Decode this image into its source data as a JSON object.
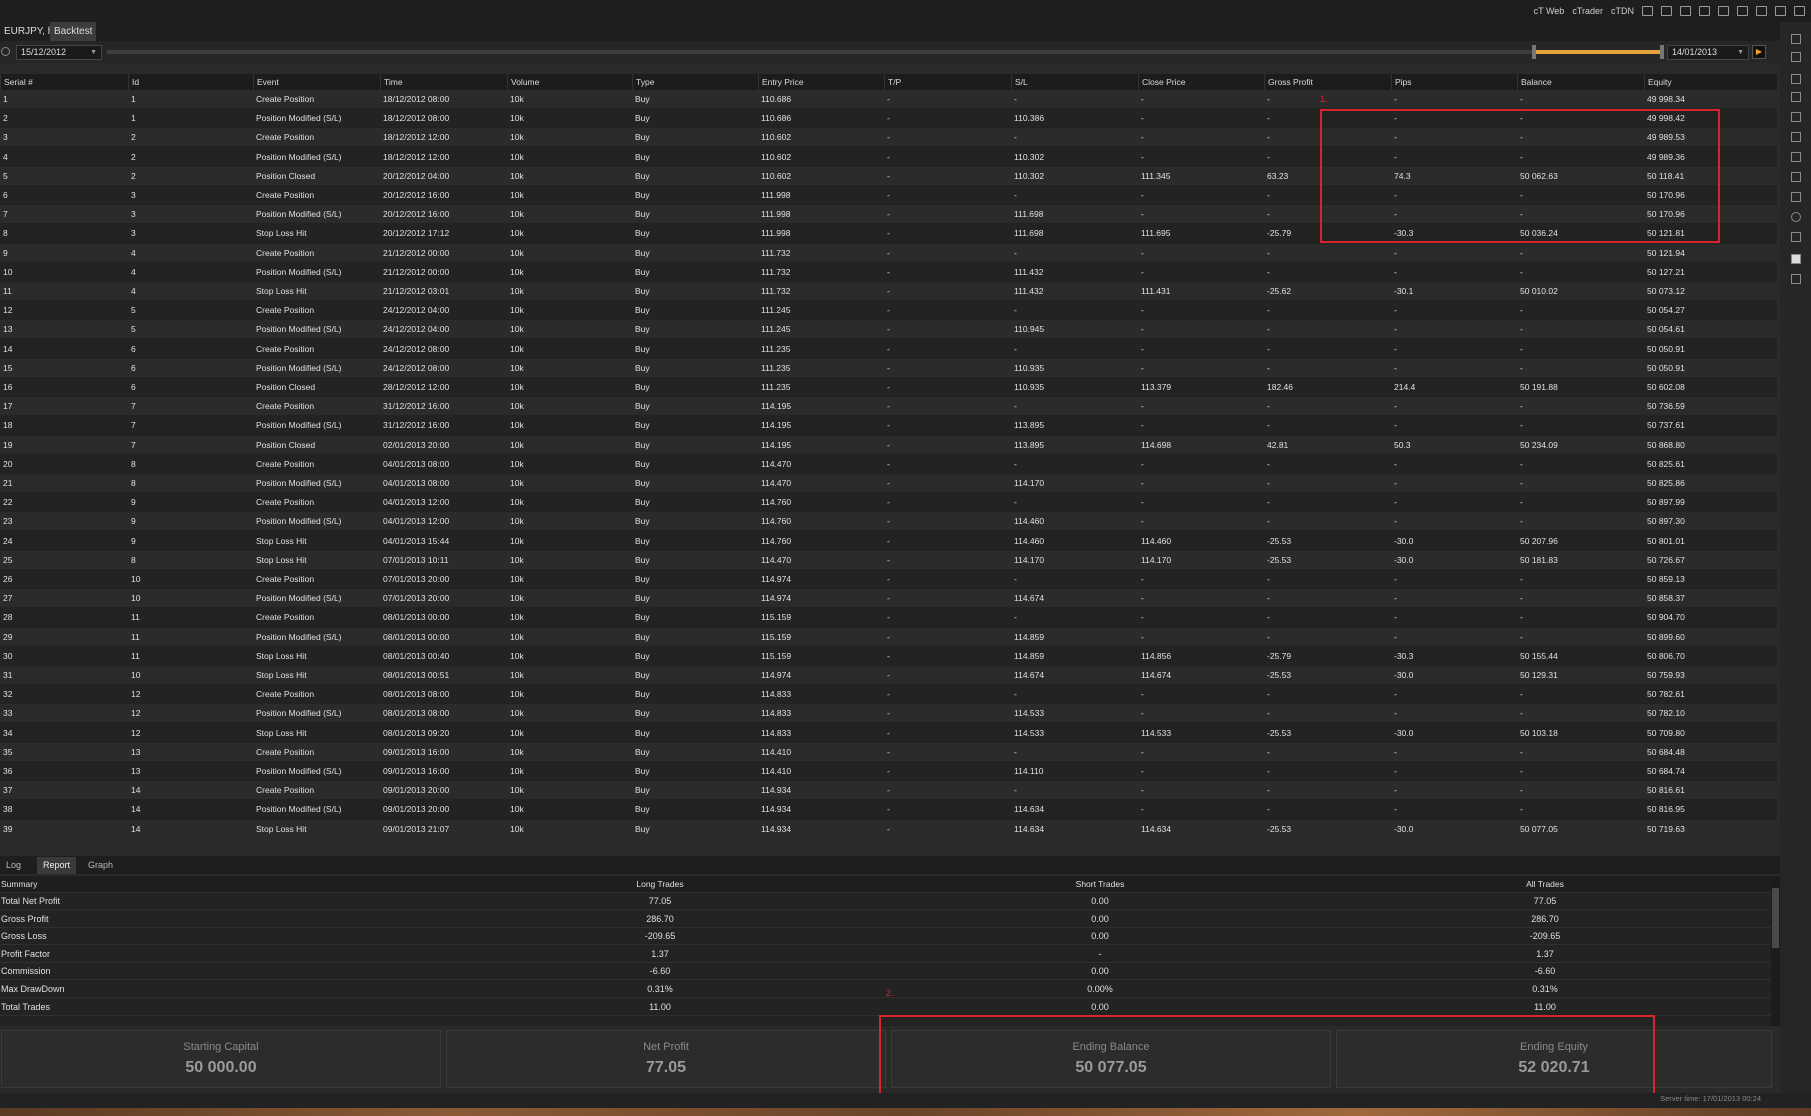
{
  "window": {
    "title": "EURJPY, h4",
    "tab_backtest": "Backtest"
  },
  "top_links": [
    "cT Web",
    "cTrader",
    "cTDN"
  ],
  "date_from": "15/12/2012",
  "date_to": "14/01/2013",
  "table": {
    "columns": [
      "Serial #",
      "Id",
      "Event",
      "Time",
      "Volume",
      "Type",
      "Entry Price",
      "T/P",
      "S/L",
      "Close Price",
      "Gross Profit",
      "Pips",
      "Balance",
      "Equity"
    ],
    "rows": [
      [
        "1",
        "1",
        "Create Position",
        "18/12/2012 08:00",
        "10k",
        "Buy",
        "110.686",
        "-",
        "-",
        "-",
        "-",
        "-",
        "-",
        "49 998.34"
      ],
      [
        "2",
        "1",
        "Position Modified (S/L)",
        "18/12/2012 08:00",
        "10k",
        "Buy",
        "110.686",
        "-",
        "110.386",
        "-",
        "-",
        "-",
        "-",
        "49 998.42"
      ],
      [
        "3",
        "2",
        "Create Position",
        "18/12/2012 12:00",
        "10k",
        "Buy",
        "110.602",
        "-",
        "-",
        "-",
        "-",
        "-",
        "-",
        "49 989.53"
      ],
      [
        "4",
        "2",
        "Position Modified (S/L)",
        "18/12/2012 12:00",
        "10k",
        "Buy",
        "110.602",
        "-",
        "110.302",
        "-",
        "-",
        "-",
        "-",
        "49 989.36"
      ],
      [
        "5",
        "2",
        "Position Closed",
        "20/12/2012 04:00",
        "10k",
        "Buy",
        "110.602",
        "-",
        "110.302",
        "111.345",
        "63.23",
        "74.3",
        "50 062.63",
        "50 118.41"
      ],
      [
        "6",
        "3",
        "Create Position",
        "20/12/2012 16:00",
        "10k",
        "Buy",
        "111.998",
        "-",
        "-",
        "-",
        "-",
        "-",
        "-",
        "50 170.96"
      ],
      [
        "7",
        "3",
        "Position Modified (S/L)",
        "20/12/2012 16:00",
        "10k",
        "Buy",
        "111.998",
        "-",
        "111.698",
        "-",
        "-",
        "-",
        "-",
        "50 170.96"
      ],
      [
        "8",
        "3",
        "Stop Loss Hit",
        "20/12/2012 17:12",
        "10k",
        "Buy",
        "111.998",
        "-",
        "111.698",
        "111.695",
        "-25.79",
        "-30.3",
        "50 036.24",
        "50 121.81"
      ],
      [
        "9",
        "4",
        "Create Position",
        "21/12/2012 00:00",
        "10k",
        "Buy",
        "111.732",
        "-",
        "-",
        "-",
        "-",
        "-",
        "-",
        "50 121.94"
      ],
      [
        "10",
        "4",
        "Position Modified (S/L)",
        "21/12/2012 00:00",
        "10k",
        "Buy",
        "111.732",
        "-",
        "111.432",
        "-",
        "-",
        "-",
        "-",
        "50 127.21"
      ],
      [
        "11",
        "4",
        "Stop Loss Hit",
        "21/12/2012 03:01",
        "10k",
        "Buy",
        "111.732",
        "-",
        "111.432",
        "111.431",
        "-25.62",
        "-30.1",
        "50 010.02",
        "50 073.12"
      ],
      [
        "12",
        "5",
        "Create Position",
        "24/12/2012 04:00",
        "10k",
        "Buy",
        "111.245",
        "-",
        "-",
        "-",
        "-",
        "-",
        "-",
        "50 054.27"
      ],
      [
        "13",
        "5",
        "Position Modified (S/L)",
        "24/12/2012 04:00",
        "10k",
        "Buy",
        "111.245",
        "-",
        "110.945",
        "-",
        "-",
        "-",
        "-",
        "50 054.61"
      ],
      [
        "14",
        "6",
        "Create Position",
        "24/12/2012 08:00",
        "10k",
        "Buy",
        "111.235",
        "-",
        "-",
        "-",
        "-",
        "-",
        "-",
        "50 050.91"
      ],
      [
        "15",
        "6",
        "Position Modified (S/L)",
        "24/12/2012 08:00",
        "10k",
        "Buy",
        "111.235",
        "-",
        "110.935",
        "-",
        "-",
        "-",
        "-",
        "50 050.91"
      ],
      [
        "16",
        "6",
        "Position Closed",
        "28/12/2012 12:00",
        "10k",
        "Buy",
        "111.235",
        "-",
        "110.935",
        "113.379",
        "182.46",
        "214.4",
        "50 191.88",
        "50 602.08"
      ],
      [
        "17",
        "7",
        "Create Position",
        "31/12/2012 16:00",
        "10k",
        "Buy",
        "114.195",
        "-",
        "-",
        "-",
        "-",
        "-",
        "-",
        "50 736.59"
      ],
      [
        "18",
        "7",
        "Position Modified (S/L)",
        "31/12/2012 16:00",
        "10k",
        "Buy",
        "114.195",
        "-",
        "113.895",
        "-",
        "-",
        "-",
        "-",
        "50 737.61"
      ],
      [
        "19",
        "7",
        "Position Closed",
        "02/01/2013 20:00",
        "10k",
        "Buy",
        "114.195",
        "-",
        "113.895",
        "114.698",
        "42.81",
        "50.3",
        "50 234.09",
        "50 868.80"
      ],
      [
        "20",
        "8",
        "Create Position",
        "04/01/2013 08:00",
        "10k",
        "Buy",
        "114.470",
        "-",
        "-",
        "-",
        "-",
        "-",
        "-",
        "50 825.61"
      ],
      [
        "21",
        "8",
        "Position Modified (S/L)",
        "04/01/2013 08:00",
        "10k",
        "Buy",
        "114.470",
        "-",
        "114.170",
        "-",
        "-",
        "-",
        "-",
        "50 825.86"
      ],
      [
        "22",
        "9",
        "Create Position",
        "04/01/2013 12:00",
        "10k",
        "Buy",
        "114.760",
        "-",
        "-",
        "-",
        "-",
        "-",
        "-",
        "50 897.99"
      ],
      [
        "23",
        "9",
        "Position Modified (S/L)",
        "04/01/2013 12:00",
        "10k",
        "Buy",
        "114.760",
        "-",
        "114.460",
        "-",
        "-",
        "-",
        "-",
        "50 897.30"
      ],
      [
        "24",
        "9",
        "Stop Loss Hit",
        "04/01/2013 15:44",
        "10k",
        "Buy",
        "114.760",
        "-",
        "114.460",
        "114.460",
        "-25.53",
        "-30.0",
        "50 207.96",
        "50 801.01"
      ],
      [
        "25",
        "8",
        "Stop Loss Hit",
        "07/01/2013 10:11",
        "10k",
        "Buy",
        "114.470",
        "-",
        "114.170",
        "114.170",
        "-25.53",
        "-30.0",
        "50 181.83",
        "50 726.67"
      ],
      [
        "26",
        "10",
        "Create Position",
        "07/01/2013 20:00",
        "10k",
        "Buy",
        "114.974",
        "-",
        "-",
        "-",
        "-",
        "-",
        "-",
        "50 859.13"
      ],
      [
        "27",
        "10",
        "Position Modified (S/L)",
        "07/01/2013 20:00",
        "10k",
        "Buy",
        "114.974",
        "-",
        "114.674",
        "-",
        "-",
        "-",
        "-",
        "50 858.37"
      ],
      [
        "28",
        "11",
        "Create Position",
        "08/01/2013 00:00",
        "10k",
        "Buy",
        "115.159",
        "-",
        "-",
        "-",
        "-",
        "-",
        "-",
        "50 904.70"
      ],
      [
        "29",
        "11",
        "Position Modified (S/L)",
        "08/01/2013 00:00",
        "10k",
        "Buy",
        "115.159",
        "-",
        "114.859",
        "-",
        "-",
        "-",
        "-",
        "50 899.60"
      ],
      [
        "30",
        "11",
        "Stop Loss Hit",
        "08/01/2013 00:40",
        "10k",
        "Buy",
        "115.159",
        "-",
        "114.859",
        "114.856",
        "-25.79",
        "-30.3",
        "50 155.44",
        "50 806.70"
      ],
      [
        "31",
        "10",
        "Stop Loss Hit",
        "08/01/2013 00:51",
        "10k",
        "Buy",
        "114.974",
        "-",
        "114.674",
        "114.674",
        "-25.53",
        "-30.0",
        "50 129.31",
        "50 759.93"
      ],
      [
        "32",
        "12",
        "Create Position",
        "08/01/2013 08:00",
        "10k",
        "Buy",
        "114.833",
        "-",
        "-",
        "-",
        "-",
        "-",
        "-",
        "50 782.61"
      ],
      [
        "33",
        "12",
        "Position Modified (S/L)",
        "08/01/2013 08:00",
        "10k",
        "Buy",
        "114.833",
        "-",
        "114.533",
        "-",
        "-",
        "-",
        "-",
        "50 782.10"
      ],
      [
        "34",
        "12",
        "Stop Loss Hit",
        "08/01/2013 09:20",
        "10k",
        "Buy",
        "114.833",
        "-",
        "114.533",
        "114.533",
        "-25.53",
        "-30.0",
        "50 103.18",
        "50 709.80"
      ],
      [
        "35",
        "13",
        "Create Position",
        "09/01/2013 16:00",
        "10k",
        "Buy",
        "114.410",
        "-",
        "-",
        "-",
        "-",
        "-",
        "-",
        "50 684.48"
      ],
      [
        "36",
        "13",
        "Position Modified (S/L)",
        "09/01/2013 16:00",
        "10k",
        "Buy",
        "114.410",
        "-",
        "114.110",
        "-",
        "-",
        "-",
        "-",
        "50 684.74"
      ],
      [
        "37",
        "14",
        "Create Position",
        "09/01/2013 20:00",
        "10k",
        "Buy",
        "114.934",
        "-",
        "-",
        "-",
        "-",
        "-",
        "-",
        "50 816.61"
      ],
      [
        "38",
        "14",
        "Position Modified (S/L)",
        "09/01/2013 20:00",
        "10k",
        "Buy",
        "114.934",
        "-",
        "114.634",
        "-",
        "-",
        "-",
        "-",
        "50 816.95"
      ],
      [
        "39",
        "14",
        "Stop Loss Hit",
        "09/01/2013 21:07",
        "10k",
        "Buy",
        "114.934",
        "-",
        "114.634",
        "114.634",
        "-25.53",
        "-30.0",
        "50 077.05",
        "50 719.63"
      ]
    ]
  },
  "bottom_tabs": [
    "Log",
    "Report",
    "Graph"
  ],
  "summary": {
    "columns": [
      "Summary",
      "Long Trades",
      "Short Trades",
      "All Trades"
    ],
    "rows": [
      [
        "Total Net Profit",
        "77.05",
        "0.00",
        "77.05"
      ],
      [
        "Gross Profit",
        "286.70",
        "0.00",
        "286.70"
      ],
      [
        "Gross Loss",
        "-209.65",
        "0.00",
        "-209.65"
      ],
      [
        "Profit Factor",
        "1.37",
        "-",
        "1.37"
      ],
      [
        "Commission",
        "-6.60",
        "0.00",
        "-6.60"
      ],
      [
        "Max DrawDown",
        "0.31%",
        "0.00%",
        "0.31%"
      ],
      [
        "Total Trades",
        "11.00",
        "0.00",
        "11.00"
      ]
    ]
  },
  "stats": [
    {
      "label": "Starting Capital",
      "value": "50 000.00"
    },
    {
      "label": "Net Profit",
      "value": "77.05"
    },
    {
      "label": "Ending Balance",
      "value": "50 077.05"
    },
    {
      "label": "Ending Equity",
      "value": "52 020.71"
    }
  ],
  "annotations": [
    "1.",
    "2."
  ],
  "server_time": "Server time: 17/01/2013 00:24",
  "colors": {
    "highlight": "#d8252b",
    "accent": "#e3a23a",
    "background": "#2a2a2a"
  }
}
